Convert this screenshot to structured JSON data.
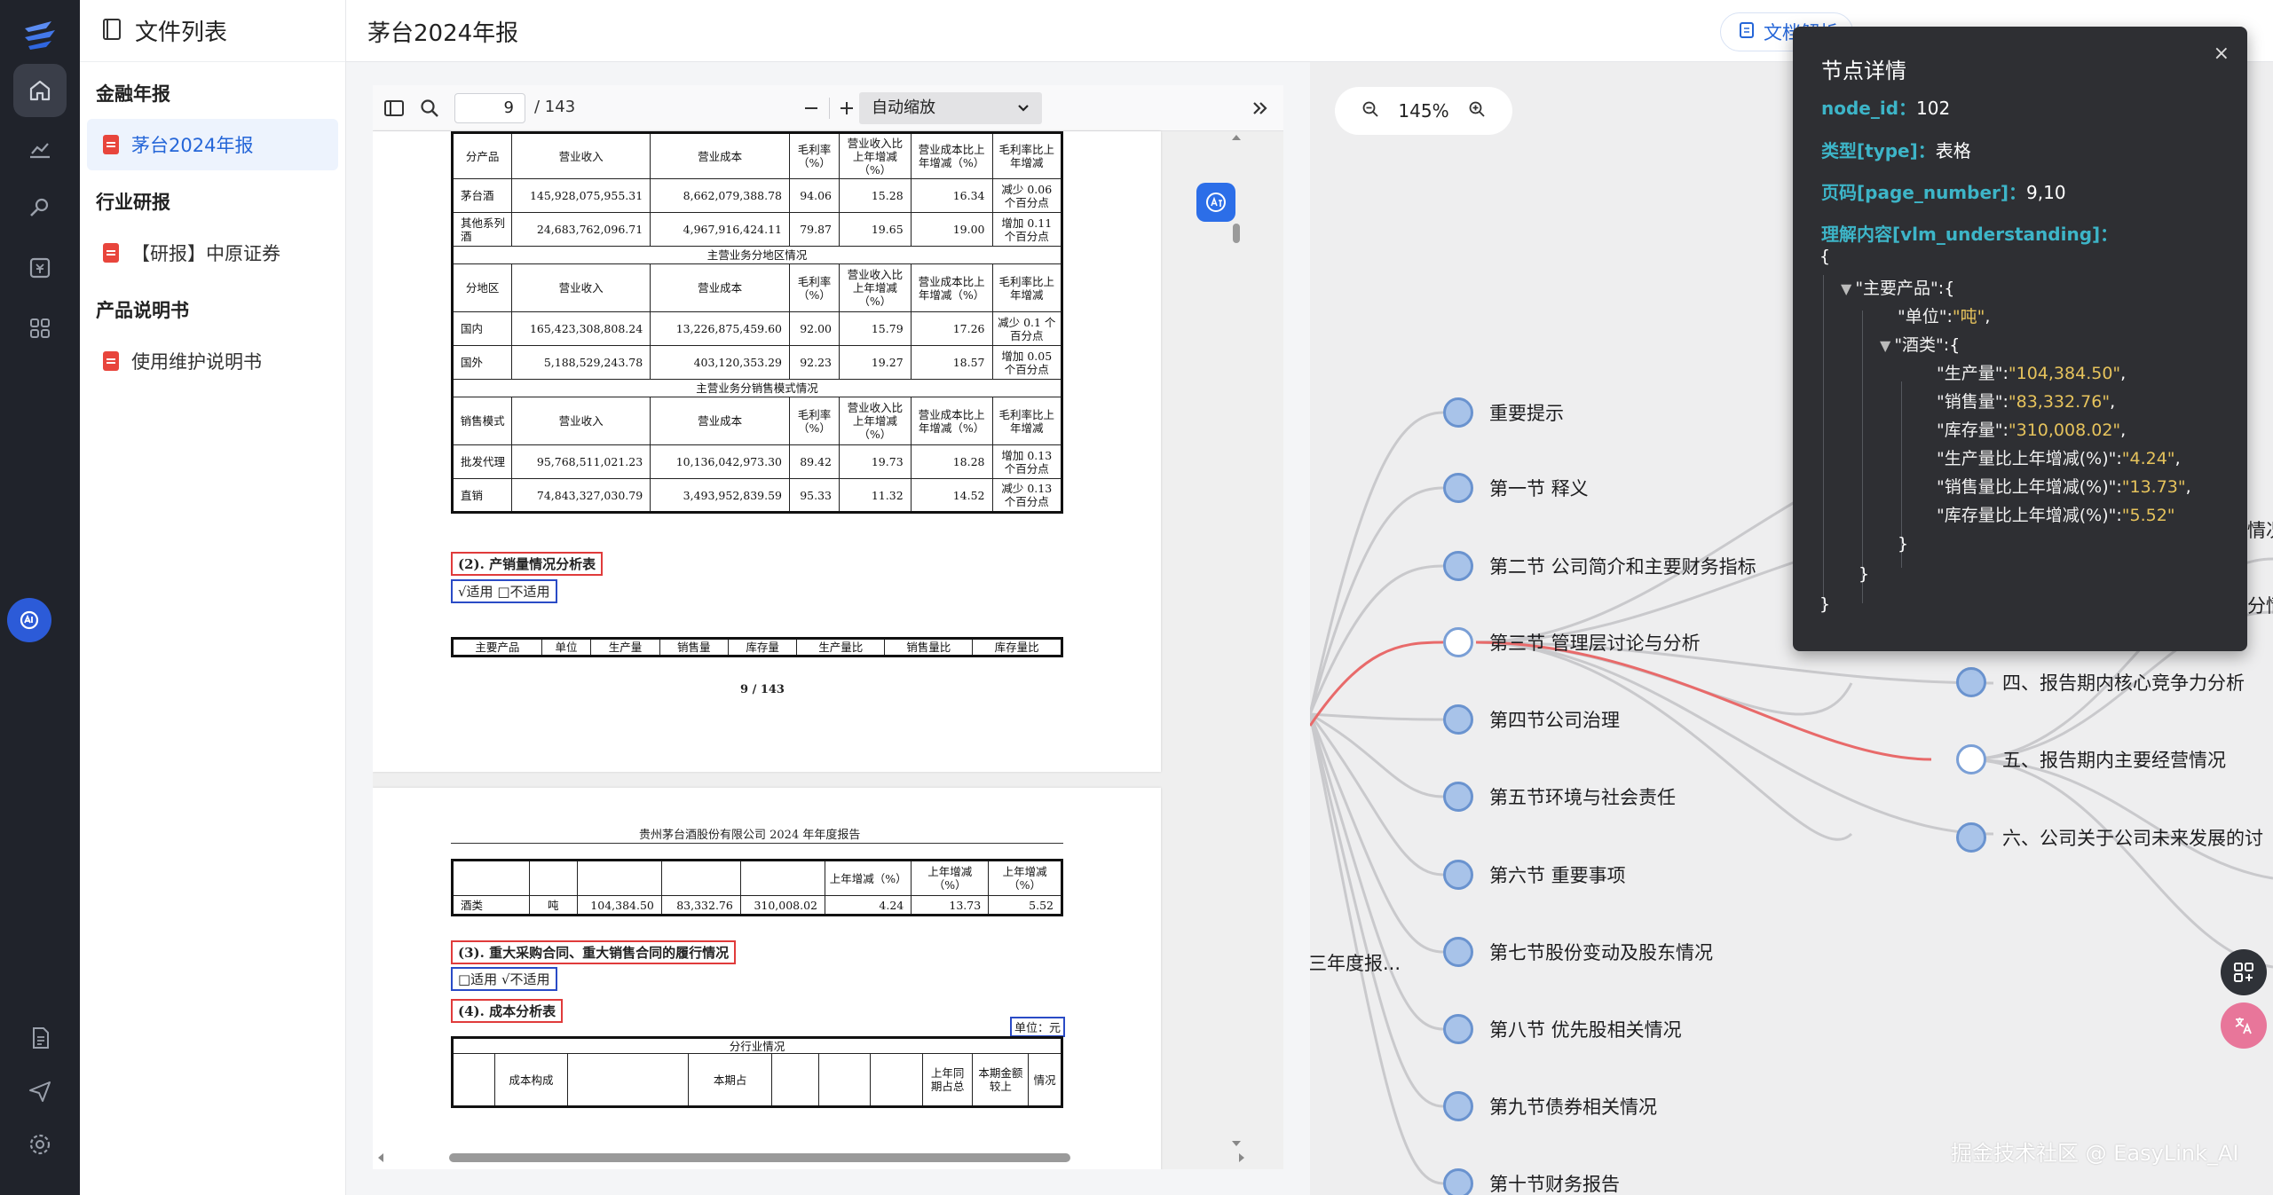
{
  "sidebar": {
    "title": "文件列表",
    "groups": [
      {
        "title": "金融年报",
        "items": [
          {
            "label": "茅台2024年报",
            "active": true
          }
        ]
      },
      {
        "title": "行业研报",
        "items": [
          {
            "label": "【研报】中原证券"
          }
        ]
      },
      {
        "title": "产品说明书",
        "items": [
          {
            "label": "使用维护说明书"
          }
        ]
      }
    ]
  },
  "topbar": {
    "doc_title": "茅台2024年报",
    "parse_button": "文档解析"
  },
  "viewer": {
    "page_value": "9",
    "page_total": "/ 143",
    "zoom_mode": "自动缩放",
    "page1": {
      "product_table": {
        "header": [
          "分产品",
          "营业收入",
          "营业成本",
          "毛利率（%）",
          "营业收入比上年增减（%）",
          "营业成本比上年增减（%）",
          "毛利率比上年增减"
        ],
        "rows": [
          [
            "茅台酒",
            "145,928,075,955.31",
            "8,662,079,388.78",
            "94.06",
            "15.28",
            "16.34",
            "减少 0.06 个百分点"
          ],
          [
            "其他系列酒",
            "24,683,762,096.71",
            "4,967,916,424.11",
            "79.87",
            "19.65",
            "19.00",
            "增加 0.11 个百分点"
          ]
        ],
        "region_section": "主营业务分地区情况",
        "region_header": [
          "分地区",
          "营业收入",
          "营业成本",
          "毛利率（%）",
          "营业收入比上年增减（%）",
          "营业成本比上年增减（%）",
          "毛利率比上年增减"
        ],
        "region_rows": [
          [
            "国内",
            "165,423,308,808.24",
            "13,226,875,459.60",
            "92.00",
            "15.79",
            "17.26",
            "减少 0.1 个百分点"
          ],
          [
            "国外",
            "5,188,529,243.78",
            "403,120,353.29",
            "92.23",
            "19.27",
            "18.57",
            "增加 0.05 个百分点"
          ]
        ],
        "model_section": "主营业务分销售模式情况",
        "model_header": [
          "销售模式",
          "营业收入",
          "营业成本",
          "毛利率（%）",
          "营业收入比上年增减（%）",
          "营业成本比上年增减（%）",
          "毛利率比上年增减"
        ],
        "model_rows": [
          [
            "批发代理",
            "95,768,511,021.23",
            "10,136,042,973.30",
            "89.42",
            "19.73",
            "18.28",
            "增加 0.13 个百分点"
          ],
          [
            "直销",
            "74,843,327,030.79",
            "3,493,952,839.59",
            "95.33",
            "11.32",
            "14.52",
            "减少 0.13 个百分点"
          ]
        ]
      },
      "section2_title": "(2). 产销量情况分析表",
      "section2_check": "√适用 □不适用",
      "prod_header": [
        "主要产品",
        "单位",
        "生产量",
        "销售量",
        "库存量",
        "生产量比",
        "销售量比",
        "库存量比"
      ],
      "page_number": "9 / 143"
    },
    "page2": {
      "header": "贵州茅台酒股份有限公司 2024 年年度报告",
      "cont_header": [
        "上年增减（%）",
        "上年增减（%）",
        "上年增减（%）"
      ],
      "cont_row": [
        "酒类",
        "吨",
        "104,384.50",
        "83,332.76",
        "310,008.02",
        "4.24",
        "13.73",
        "5.52"
      ],
      "section3_title": "(3). 重大采购合同、重大销售合同的履行情况",
      "section3_check": "□适用 √不适用",
      "section4_title": "(4). 成本分析表",
      "unit": "单位：元",
      "industry_section": "分行业情况",
      "cost_header": [
        "成本构成",
        "本期占",
        "上年同期占总",
        "本期金额较上",
        "情况"
      ]
    }
  },
  "mindmap": {
    "zoom": "145%",
    "root_label": "年度报...",
    "root_prefix": "三",
    "nodes": [
      {
        "label": "重要提示"
      },
      {
        "label": "第一节 释义"
      },
      {
        "label": "第二节 公司简介和主要财务指标"
      },
      {
        "label": "第三节 管理层讨论与分析",
        "selected": true
      },
      {
        "label": "第四节公司治理"
      },
      {
        "label": "第五节环境与社会责任"
      },
      {
        "label": "第六节 重要事项"
      },
      {
        "label": "第七节股份变动及股东情况"
      },
      {
        "label": "第八节 优先股相关情况"
      },
      {
        "label": "第九节债券相关情况"
      },
      {
        "label": "第十节财务报告"
      }
    ],
    "sub_nodes": [
      {
        "label": "四、报告期内核心竞争力分析"
      },
      {
        "label": "五、报告期内主要经营情况",
        "selected": true
      },
      {
        "label": "六、公司关于公司未来发展的讨"
      }
    ],
    "right_clips": [
      "情况",
      "分情"
    ],
    "watermark": "掘金技术社区 @ EasyLink_AI",
    "colors": {
      "line": "#c9c9cc",
      "highlight": "#e86a6a",
      "node_fill": "#a8c3e9",
      "node_border": "#6a93cf"
    }
  },
  "detail": {
    "title": "节点详情",
    "close": "×",
    "node_id_key": "node_id：",
    "node_id": "102",
    "type_key": "类型[type]：",
    "type": "表格",
    "page_key": "页码[page_number]：",
    "page": "9,10",
    "vlm_key": "理解内容[vlm_understanding]：",
    "json": {
      "open": "{",
      "k_main": "\"主要产品\"",
      "k_unit": "\"单位\"",
      "v_unit": "\"吨\"",
      "k_liquor": "\"酒类\"",
      "fields": [
        {
          "k": "\"生产量\"",
          "v": "\"104,384.50\""
        },
        {
          "k": "\"销售量\"",
          "v": "\"83,332.76\""
        },
        {
          "k": "\"库存量\"",
          "v": "\"310,008.02\""
        },
        {
          "k": "\"生产量比上年增减(%)\"",
          "v": "\"4.24\""
        },
        {
          "k": "\"销售量比上年增减(%)\"",
          "v": "\"13.73\""
        },
        {
          "k": "\"库存量比上年增减(%)\"",
          "v": "\"5.52\""
        }
      ],
      "close": "}"
    }
  }
}
